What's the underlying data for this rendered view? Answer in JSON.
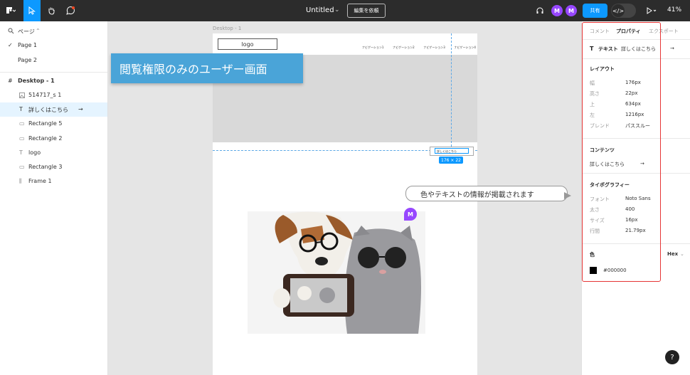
{
  "topbar": {
    "title": "Untitled",
    "title_chevron": "⌄",
    "request_label": "編集を依頼",
    "share_label": "共有",
    "zoom_label": "41%",
    "code_icon": "</>",
    "avatars": [
      "M",
      "M"
    ]
  },
  "left": {
    "pages_label": "ページ",
    "pages": [
      "Page 1",
      "Page 2"
    ],
    "frame_name": "Desktop - 1",
    "layers": [
      "514717_s 1",
      "詳しくはこちら",
      "Rectangle 5",
      "Rectangle 2",
      "logo",
      "Rectangle 3",
      "Frame 1"
    ]
  },
  "canvas": {
    "frame_label": "Desktop - 1",
    "logo_text": "logo",
    "nav_items": [
      "ナビゲーション1",
      "ナビゲーション2",
      "ナビゲーション3",
      "ナビゲーション4"
    ],
    "banner_text": "閲覧権限のみのユーザー画面",
    "button_text": "詳しくはこちら",
    "size_badge": "176 × 22",
    "callout_text": "色やテキストの情報が掲載されます",
    "cursor_avatar": "M"
  },
  "right": {
    "tabs": [
      "コメント",
      "プロパティ",
      "エクスポート"
    ],
    "text_layer_label": "テキスト",
    "text_layer_name": "詳しくはこちら",
    "layout_heading": "レイアウト",
    "layout": [
      {
        "label": "幅",
        "value": "176px"
      },
      {
        "label": "高さ",
        "value": "22px"
      },
      {
        "label": "上",
        "value": "634px"
      },
      {
        "label": "左",
        "value": "1216px"
      },
      {
        "label": "ブレンド",
        "value": "パススルー"
      }
    ],
    "contents_heading": "コンテンツ",
    "contents_value": "詳しくはこちら",
    "typo_heading": "タイポグラフィー",
    "typography": [
      {
        "label": "フォント",
        "value": "Noto Sans"
      },
      {
        "label": "太さ",
        "value": "400"
      },
      {
        "label": "サイズ",
        "value": "16px"
      },
      {
        "label": "行間",
        "value": "21.79px"
      }
    ],
    "color_heading": "色",
    "color_format": "Hex",
    "color_value": "#000000",
    "help_label": "?"
  }
}
